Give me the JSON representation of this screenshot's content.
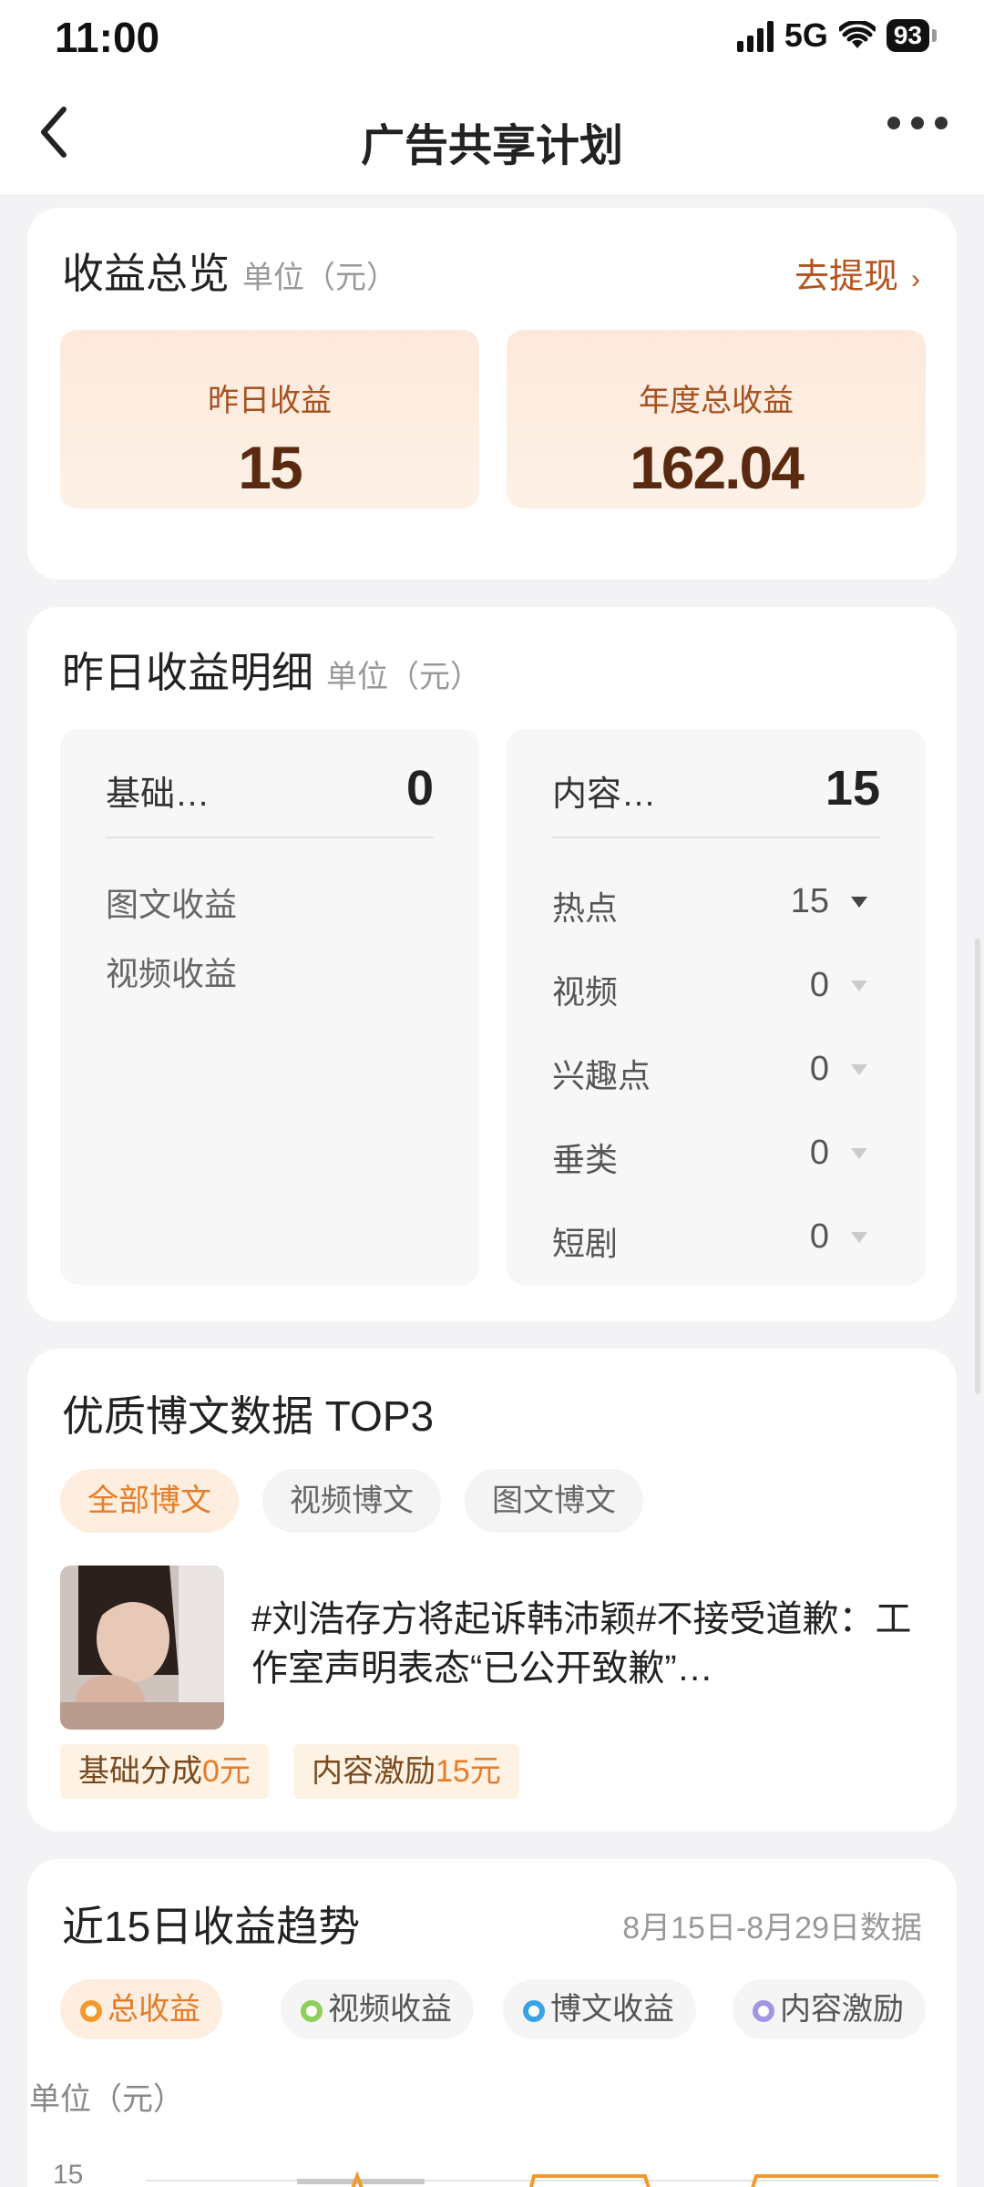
{
  "status_bar": {
    "time": "11:00",
    "network": "5G",
    "battery": "93"
  },
  "nav": {
    "title": "广告共享计划"
  },
  "overview": {
    "title": "收益总览",
    "unit": "单位（元）",
    "withdraw_label": "去提现",
    "withdraw_chevron": "›",
    "yesterday_label": "昨日收益",
    "yesterday_value": "15",
    "annual_label": "年度总收益",
    "annual_value": "162.04"
  },
  "detail": {
    "title": "昨日收益明细",
    "unit": "单位（元）",
    "basic": {
      "label": "基础…",
      "value": "0",
      "items": [
        "图文收益",
        "视频收益"
      ]
    },
    "content": {
      "label": "内容…",
      "value": "15",
      "rows": [
        {
          "label": "热点",
          "value": "15"
        },
        {
          "label": "视频",
          "value": "0"
        },
        {
          "label": "兴趣点",
          "value": "0"
        },
        {
          "label": "垂类",
          "value": "0"
        },
        {
          "label": "短剧",
          "value": "0"
        }
      ]
    }
  },
  "top3": {
    "title": "优质博文数据 TOP3",
    "tabs": [
      "全部博文",
      "视频博文",
      "图文博文"
    ],
    "post": {
      "text": "#刘浩存方将起诉韩沛颖#不接受道歉：工作室声明表态“已公开致歉”…",
      "tag_basic_label": "基础分成",
      "tag_basic_value": "0元",
      "tag_content_label": "内容激励",
      "tag_content_value": "15元"
    }
  },
  "trend": {
    "title": "近15日收益趋势",
    "range": "8月15日-8月29日数据",
    "legend": [
      {
        "label": "总收益",
        "color": "#f39a2e"
      },
      {
        "label": "视频收益",
        "color": "#8fce5a"
      },
      {
        "label": "博文收益",
        "color": "#3aa3e8"
      },
      {
        "label": "内容激励",
        "color": "#a394e6"
      }
    ],
    "unit": "单位（元）",
    "y_top": "15"
  }
}
